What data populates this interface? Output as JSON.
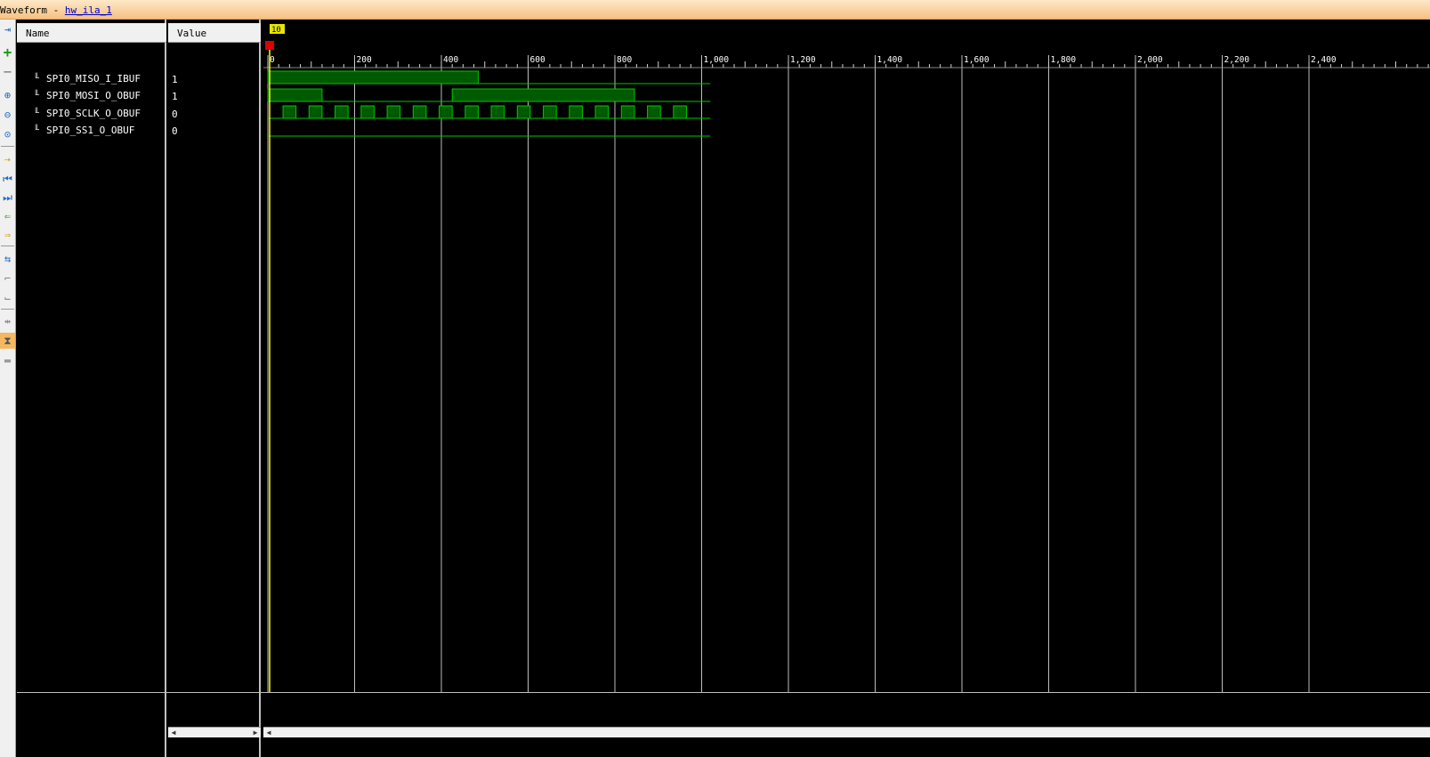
{
  "window": {
    "title_prefix": "Waveform - ",
    "title_link": "hw_ila_1"
  },
  "columns": {
    "name": "Name",
    "value": "Value"
  },
  "signals": [
    {
      "name": "SPI0_MISO_I_IBUF",
      "value": "1"
    },
    {
      "name": "SPI0_MOSI_O_OBUF",
      "value": "1"
    },
    {
      "name": "SPI0_SCLK_O_OBUF",
      "value": "0"
    },
    {
      "name": "SPI0_SS1_O_OBUF",
      "value": "0"
    }
  ],
  "cursor": {
    "label": "10"
  },
  "ruler": {
    "labels": [
      "0",
      "200",
      "400",
      "600",
      "800",
      "1,000",
      "1,200",
      "1,400",
      "1,600",
      "1,800",
      "2,000",
      "2,200",
      "2,400"
    ]
  },
  "toolbar": {
    "icons": [
      "expand-icon",
      "add-icon",
      "remove-icon",
      "zoom-in-icon",
      "zoom-out-icon",
      "zoom-fit-icon",
      "go-to-cursor-icon",
      "prev-transition-icon",
      "next-transition-icon",
      "add-marker-icon",
      "prev-marker-icon",
      "swap-cursors-icon",
      "snap-icon",
      "floating-ruler-icon",
      "link-icon",
      "settings-icon"
    ]
  },
  "colors": {
    "title_bg": "#f6c183",
    "wave": "#00c800",
    "wave_fill": "#005a00",
    "cursor": "#ffff00",
    "grid": "#bdbdbd",
    "marker": "#ff0000"
  }
}
